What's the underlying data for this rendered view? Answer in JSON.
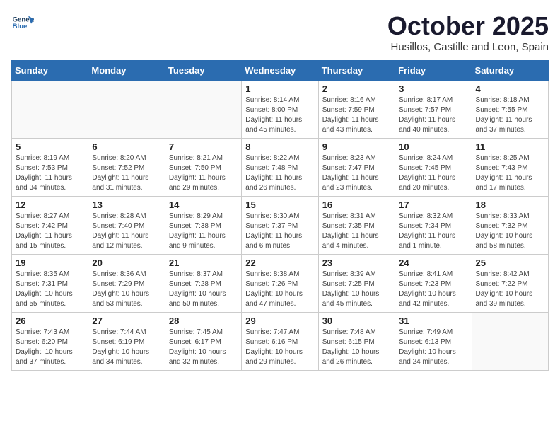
{
  "header": {
    "logo_line1": "General",
    "logo_line2": "Blue",
    "month_title": "October 2025",
    "subtitle": "Husillos, Castille and Leon, Spain"
  },
  "weekdays": [
    "Sunday",
    "Monday",
    "Tuesday",
    "Wednesday",
    "Thursday",
    "Friday",
    "Saturday"
  ],
  "weeks": [
    [
      {
        "day": "",
        "info": ""
      },
      {
        "day": "",
        "info": ""
      },
      {
        "day": "",
        "info": ""
      },
      {
        "day": "1",
        "info": "Sunrise: 8:14 AM\nSunset: 8:00 PM\nDaylight: 11 hours and 45 minutes."
      },
      {
        "day": "2",
        "info": "Sunrise: 8:16 AM\nSunset: 7:59 PM\nDaylight: 11 hours and 43 minutes."
      },
      {
        "day": "3",
        "info": "Sunrise: 8:17 AM\nSunset: 7:57 PM\nDaylight: 11 hours and 40 minutes."
      },
      {
        "day": "4",
        "info": "Sunrise: 8:18 AM\nSunset: 7:55 PM\nDaylight: 11 hours and 37 minutes."
      }
    ],
    [
      {
        "day": "5",
        "info": "Sunrise: 8:19 AM\nSunset: 7:53 PM\nDaylight: 11 hours and 34 minutes."
      },
      {
        "day": "6",
        "info": "Sunrise: 8:20 AM\nSunset: 7:52 PM\nDaylight: 11 hours and 31 minutes."
      },
      {
        "day": "7",
        "info": "Sunrise: 8:21 AM\nSunset: 7:50 PM\nDaylight: 11 hours and 29 minutes."
      },
      {
        "day": "8",
        "info": "Sunrise: 8:22 AM\nSunset: 7:48 PM\nDaylight: 11 hours and 26 minutes."
      },
      {
        "day": "9",
        "info": "Sunrise: 8:23 AM\nSunset: 7:47 PM\nDaylight: 11 hours and 23 minutes."
      },
      {
        "day": "10",
        "info": "Sunrise: 8:24 AM\nSunset: 7:45 PM\nDaylight: 11 hours and 20 minutes."
      },
      {
        "day": "11",
        "info": "Sunrise: 8:25 AM\nSunset: 7:43 PM\nDaylight: 11 hours and 17 minutes."
      }
    ],
    [
      {
        "day": "12",
        "info": "Sunrise: 8:27 AM\nSunset: 7:42 PM\nDaylight: 11 hours and 15 minutes."
      },
      {
        "day": "13",
        "info": "Sunrise: 8:28 AM\nSunset: 7:40 PM\nDaylight: 11 hours and 12 minutes."
      },
      {
        "day": "14",
        "info": "Sunrise: 8:29 AM\nSunset: 7:38 PM\nDaylight: 11 hours and 9 minutes."
      },
      {
        "day": "15",
        "info": "Sunrise: 8:30 AM\nSunset: 7:37 PM\nDaylight: 11 hours and 6 minutes."
      },
      {
        "day": "16",
        "info": "Sunrise: 8:31 AM\nSunset: 7:35 PM\nDaylight: 11 hours and 4 minutes."
      },
      {
        "day": "17",
        "info": "Sunrise: 8:32 AM\nSunset: 7:34 PM\nDaylight: 11 hours and 1 minute."
      },
      {
        "day": "18",
        "info": "Sunrise: 8:33 AM\nSunset: 7:32 PM\nDaylight: 10 hours and 58 minutes."
      }
    ],
    [
      {
        "day": "19",
        "info": "Sunrise: 8:35 AM\nSunset: 7:31 PM\nDaylight: 10 hours and 55 minutes."
      },
      {
        "day": "20",
        "info": "Sunrise: 8:36 AM\nSunset: 7:29 PM\nDaylight: 10 hours and 53 minutes."
      },
      {
        "day": "21",
        "info": "Sunrise: 8:37 AM\nSunset: 7:28 PM\nDaylight: 10 hours and 50 minutes."
      },
      {
        "day": "22",
        "info": "Sunrise: 8:38 AM\nSunset: 7:26 PM\nDaylight: 10 hours and 47 minutes."
      },
      {
        "day": "23",
        "info": "Sunrise: 8:39 AM\nSunset: 7:25 PM\nDaylight: 10 hours and 45 minutes."
      },
      {
        "day": "24",
        "info": "Sunrise: 8:41 AM\nSunset: 7:23 PM\nDaylight: 10 hours and 42 minutes."
      },
      {
        "day": "25",
        "info": "Sunrise: 8:42 AM\nSunset: 7:22 PM\nDaylight: 10 hours and 39 minutes."
      }
    ],
    [
      {
        "day": "26",
        "info": "Sunrise: 7:43 AM\nSunset: 6:20 PM\nDaylight: 10 hours and 37 minutes."
      },
      {
        "day": "27",
        "info": "Sunrise: 7:44 AM\nSunset: 6:19 PM\nDaylight: 10 hours and 34 minutes."
      },
      {
        "day": "28",
        "info": "Sunrise: 7:45 AM\nSunset: 6:17 PM\nDaylight: 10 hours and 32 minutes."
      },
      {
        "day": "29",
        "info": "Sunrise: 7:47 AM\nSunset: 6:16 PM\nDaylight: 10 hours and 29 minutes."
      },
      {
        "day": "30",
        "info": "Sunrise: 7:48 AM\nSunset: 6:15 PM\nDaylight: 10 hours and 26 minutes."
      },
      {
        "day": "31",
        "info": "Sunrise: 7:49 AM\nSunset: 6:13 PM\nDaylight: 10 hours and 24 minutes."
      },
      {
        "day": "",
        "info": ""
      }
    ]
  ]
}
